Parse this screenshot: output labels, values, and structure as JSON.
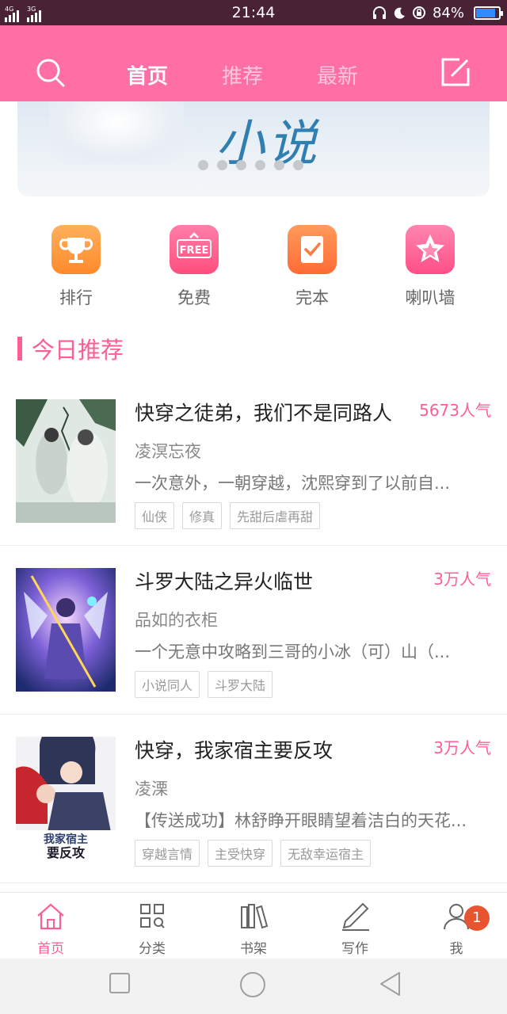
{
  "status_bar": {
    "net1": "4G",
    "net2": "3G",
    "time": "21:44",
    "battery": "84%",
    "battery_level": 0.84
  },
  "header": {
    "tabs": [
      {
        "label": "首页",
        "active": true
      },
      {
        "label": "推荐",
        "active": false
      },
      {
        "label": "最新",
        "active": false
      }
    ]
  },
  "banner": {
    "title": "小说",
    "slide_count": 6
  },
  "quick_entries": [
    {
      "label": "排行",
      "icon": "trophy-icon"
    },
    {
      "label": "免费",
      "icon": "free-icon",
      "icon_text": "FREE"
    },
    {
      "label": "完本",
      "icon": "complete-icon"
    },
    {
      "label": "喇叭墙",
      "icon": "star-icon"
    }
  ],
  "section": {
    "title": "今日推荐"
  },
  "books": [
    {
      "title": "快穿之徒弟，我们不是同路人",
      "popularity": "5673人气",
      "author": "凌溟忘夜",
      "desc": "一次意外，一朝穿越，沈熙穿到了以前自...",
      "tags": [
        "仙侠",
        "修真",
        "先甜后虐再甜"
      ]
    },
    {
      "title": "斗罗大陆之异火临世",
      "popularity": "3万人气",
      "author": "品如的衣柜",
      "desc": "一个无意中攻略到三哥的小冰（可）山（...",
      "tags": [
        "小说同人",
        "斗罗大陆"
      ]
    },
    {
      "title": "快穿，我家宿主要反攻",
      "popularity": "3万人气",
      "author": "凌溧",
      "desc": "【传送成功】林舒睁开眼睛望着洁白的天花...",
      "tags": [
        "穿越言情",
        "主受快穿",
        "无敌幸运宿主"
      ],
      "cover_text": "我家宿主要反攻"
    }
  ],
  "bottom_nav": [
    {
      "label": "首页",
      "icon": "home-icon",
      "active": true
    },
    {
      "label": "分类",
      "icon": "category-icon",
      "active": false
    },
    {
      "label": "书架",
      "icon": "bookshelf-icon",
      "active": false
    },
    {
      "label": "写作",
      "icon": "pen-icon",
      "active": false
    },
    {
      "label": "我",
      "icon": "user-icon",
      "active": false,
      "badge": "1"
    }
  ],
  "colors": {
    "accent": "#ff5d96",
    "header": "#ff6fa5",
    "badge": "#e8542f"
  }
}
